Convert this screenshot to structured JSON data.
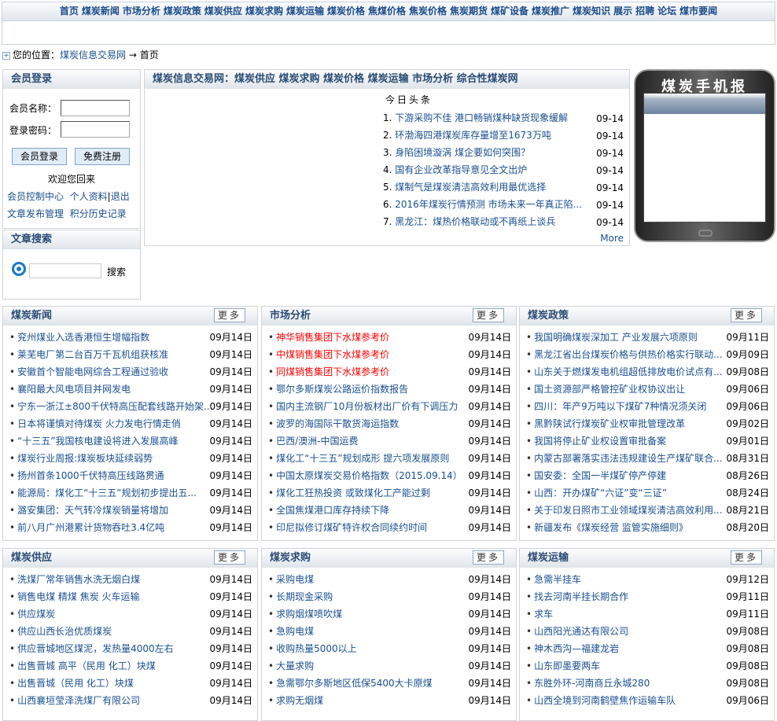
{
  "nav": [
    "首页",
    "煤炭新闻",
    "市场分析",
    "煤炭政策",
    "煤炭供应",
    "煤炭求购",
    "煤炭运输",
    "煤炭价格",
    "焦煤价格",
    "焦炭价格",
    "焦炭期货",
    "煤矿设备",
    "煤炭推广",
    "煤炭知识",
    "展示",
    "招聘",
    "论坛",
    "煤市要闻"
  ],
  "breadcrumb": {
    "label": "您的位置：",
    "site": "煤炭信息交易网",
    "arrow": "→",
    "current": "首页"
  },
  "login": {
    "title": "会员登录",
    "name_label": "会员名称：",
    "pwd_label": "登录密码：",
    "login_btn": "会员登录",
    "register_btn": "免费注册",
    "welcome": "欢迎您回来",
    "links": [
      "会员控制中心",
      "个人资料",
      "退出",
      "文章发布管理",
      "积分历史记录"
    ],
    "sep": "|"
  },
  "search": {
    "title": "文章搜索",
    "button": "搜索",
    "icon": "search-icon"
  },
  "center": {
    "title": "煤炭信息交易网：煤炭供应 煤炭求购 煤炭价格 煤炭运输 市场分析 综合性煤炭网",
    "headline_title": "今日头条",
    "more": "More",
    "headlines": [
      {
        "n": "1.",
        "t": "下游采购不佳 港口畅销煤种缺货现象缓解",
        "d": "09-14"
      },
      {
        "n": "2.",
        "t": "环渤海四港煤炭库存量增至1673万吨",
        "d": "09-14"
      },
      {
        "n": "3.",
        "t": "身陷困境漩涡 煤企要如何突围？",
        "d": "09-14"
      },
      {
        "n": "4.",
        "t": "国有企业改革指导意见全文出炉",
        "d": "09-14"
      },
      {
        "n": "5.",
        "t": "煤制气是煤炭清洁高效利用最优选择",
        "d": "09-14"
      },
      {
        "n": "6.",
        "t": "2016年煤炭行情预测 市场未来一年真正陷...",
        "d": "09-14"
      },
      {
        "n": "7.",
        "t": "黑龙江：煤热价格联动或不再纸上谈兵",
        "d": "09-14"
      }
    ]
  },
  "phone": {
    "title": "煤炭手机报"
  },
  "colors": {
    "link": "#1a4f8f",
    "highlight": "#ff0000",
    "header_text": "#2a4c74"
  },
  "sections": [
    {
      "title": "煤炭新闻",
      "more": "更多",
      "items": [
        {
          "t": "兖州煤业入选香港恒生增幅指数",
          "d": "09月14日"
        },
        {
          "t": "莱芜电厂第二台百万千瓦机组获核准",
          "d": "09月14日"
        },
        {
          "t": "安徽首个智能电网综合工程通过验收",
          "d": "09月14日"
        },
        {
          "t": "襄阳最大风电项目并网发电",
          "d": "09月14日"
        },
        {
          "t": "宁东一浙江±800千伏特高压配套线路开始架...",
          "d": "09月14日"
        },
        {
          "t": "日本将谨慎对待煤炭 火力发电行情走俏",
          "d": "09月14日"
        },
        {
          "t": "“十三五”我国核电建设将进入发展高峰",
          "d": "09月14日"
        },
        {
          "t": "煤炭行业周报:煤炭板块延续弱势",
          "d": "09月14日"
        },
        {
          "t": "扬州首条1000千伏特高压线路贯通",
          "d": "09月14日"
        },
        {
          "t": "能源局：煤化工“十三五”规划初步提出五...",
          "d": "09月14日"
        },
        {
          "t": "潞安集团：天气转冷煤炭销量将增加",
          "d": "09月14日"
        },
        {
          "t": "前八月广州港累计货物吞吐3.4亿吨",
          "d": "09月14日"
        }
      ]
    },
    {
      "title": "市场分析",
      "more": "更多",
      "items": [
        {
          "t": "神华销售集团下水煤参考价",
          "d": "09月14日",
          "red": true
        },
        {
          "t": "中煤销售集团下水煤参考价",
          "d": "09月14日",
          "red": true
        },
        {
          "t": "同煤销售集团下水煤参考价",
          "d": "09月14日",
          "red": true
        },
        {
          "t": "鄂尔多斯煤炭公路运价指数报告",
          "d": "09月14日"
        },
        {
          "t": "国内主流钢厂10月份板材出厂价有下调压力",
          "d": "09月14日"
        },
        {
          "t": "波罗的海国际干散货海运指数",
          "d": "09月14日"
        },
        {
          "t": "巴西/澳洲-中国运费",
          "d": "09月14日"
        },
        {
          "t": "煤化工“十三五”规划成形 提六项发展原则",
          "d": "09月14日"
        },
        {
          "t": "中国太原煤炭交易价格指数（2015.09.14）",
          "d": "09月14日"
        },
        {
          "t": "煤化工狂热投资 或致煤化工产能过剩",
          "d": "09月14日"
        },
        {
          "t": "全国焦煤港口库存持续下降",
          "d": "09月14日"
        },
        {
          "t": "印尼拟修订煤矿特许权合同续约时间",
          "d": "09月14日"
        }
      ]
    },
    {
      "title": "煤炭政策",
      "more": "更多",
      "items": [
        {
          "t": "我国明确煤炭深加工 产业发展六项原则",
          "d": "09月11日"
        },
        {
          "t": "黑龙江省出台煤炭价格与供热价格实行联动...",
          "d": "09月09日"
        },
        {
          "t": "山东关于燃煤发电机组超低排放电价试点有...",
          "d": "09月08日"
        },
        {
          "t": "国土资源部严格管控矿业权协议出让",
          "d": "09月06日"
        },
        {
          "t": "四川：年产9万吨以下煤矿7种情况须关闭",
          "d": "09月06日"
        },
        {
          "t": "黑黔陕试行煤炭矿业权审批管理改革",
          "d": "09月02日"
        },
        {
          "t": "我国将停止矿业权设置审批备案",
          "d": "09月01日"
        },
        {
          "t": "内蒙古部署落实违法违规建设生产煤矿联合...",
          "d": "08月31日"
        },
        {
          "t": "国安委：全国一半煤矿停产停建",
          "d": "08月26日"
        },
        {
          "t": "山西：开办煤矿“六证”变“三证”",
          "d": "08月24日"
        },
        {
          "t": "关于印发日照市工业领域煤炭清洁高效利用...",
          "d": "08月21日"
        },
        {
          "t": "新疆发布《煤炭经营 监管实施细则》",
          "d": "08月20日"
        }
      ]
    },
    {
      "title": "煤炭供应",
      "more": "更多",
      "items": [
        {
          "t": "洗煤厂常年销售水洗无烟白煤",
          "d": "09月14日"
        },
        {
          "t": "销售电煤 精煤 焦炭 火车运输",
          "d": "09月14日"
        },
        {
          "t": "供应煤炭",
          "d": "09月14日"
        },
        {
          "t": "供应山西长治优质煤炭",
          "d": "09月14日"
        },
        {
          "t": "供应晋城地区煤泥，发热量4000左右",
          "d": "09月14日"
        },
        {
          "t": "出售晋城 高平（民用 化工）块煤",
          "d": "09月14日"
        },
        {
          "t": "出售晋城（民用 化工）块煤",
          "d": "09月14日"
        },
        {
          "t": "山西襄垣莹泽洗煤厂有限公司",
          "d": "09月14日"
        }
      ]
    },
    {
      "title": "煤炭求购",
      "more": "更多",
      "items": [
        {
          "t": "采购电煤",
          "d": "09月14日"
        },
        {
          "t": "长期现金采购",
          "d": "09月14日"
        },
        {
          "t": "求购烟煤喷吹煤",
          "d": "09月14日"
        },
        {
          "t": "急购电煤",
          "d": "09月14日"
        },
        {
          "t": "收购热量5000以上",
          "d": "09月14日"
        },
        {
          "t": "大量求购",
          "d": "09月14日"
        },
        {
          "t": "急需鄂尔多斯地区低保5400大卡原煤",
          "d": "09月14日"
        },
        {
          "t": "求购无烟煤",
          "d": "09月14日"
        }
      ]
    },
    {
      "title": "煤炭运输",
      "more": "更多",
      "items": [
        {
          "t": "急需半挂车",
          "d": "09月12日"
        },
        {
          "t": "找去河南半挂长期合作",
          "d": "09月11日"
        },
        {
          "t": "求车",
          "d": "09月11日"
        },
        {
          "t": "山西阳光通达有限公司",
          "d": "09月08日"
        },
        {
          "t": "神木西沟—福建龙岩",
          "d": "09月08日"
        },
        {
          "t": "山东即墨要两车",
          "d": "09月08日"
        },
        {
          "t": "东胜外环-河南商丘永城280",
          "d": "09月08日"
        },
        {
          "t": "山西全境到河南鹤壁焦作运输车队",
          "d": "09月06日"
        }
      ]
    }
  ]
}
